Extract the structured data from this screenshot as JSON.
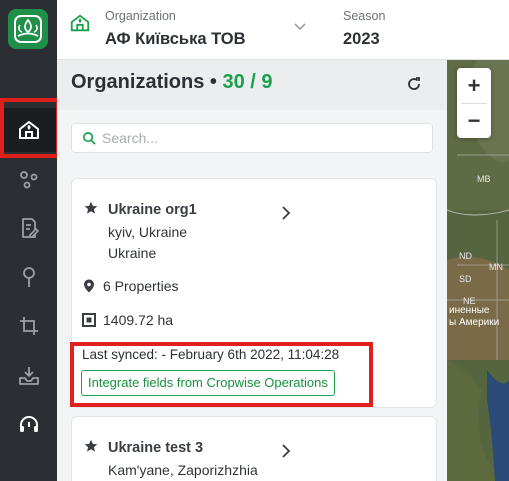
{
  "header": {
    "org_caption": "Organization",
    "org_name": "АФ Київська ТОВ",
    "season_caption": "Season",
    "season_value": "2023"
  },
  "panel": {
    "title": "Organizations",
    "separator": "•",
    "count": "30 / 9",
    "search_placeholder": "Search..."
  },
  "cards": [
    {
      "name": "Ukraine org1",
      "city": "kyiv, Ukraine",
      "country": "Ukraine",
      "properties": "6 Properties",
      "area": "1409.72 ha",
      "last_synced": "Last synced: - February 6th 2022, 11:04:28",
      "integrate_label": "Integrate fields from Cropwise Operations"
    },
    {
      "name": "Ukraine test 3",
      "city": "Kam'yane, Zaporizhzhia"
    }
  ],
  "map": {
    "zoom_in": "+",
    "zoom_out": "−",
    "labels": [
      "MB",
      "ND",
      "MN",
      "SD",
      "NE",
      "иненные",
      "ы Америки"
    ]
  },
  "colors": {
    "accent_green": "#19a04b",
    "highlight_red": "#e0201c",
    "sidebar_bg": "#2b2f33"
  },
  "icons": {
    "logo": "field-logo-icon",
    "organizations": "house-icon",
    "assets": "dots-icon",
    "notes": "note-edit-icon",
    "location": "pin-icon",
    "crop": "crop-frame-icon",
    "import": "inbox-tray-icon",
    "support": "headset-icon"
  }
}
